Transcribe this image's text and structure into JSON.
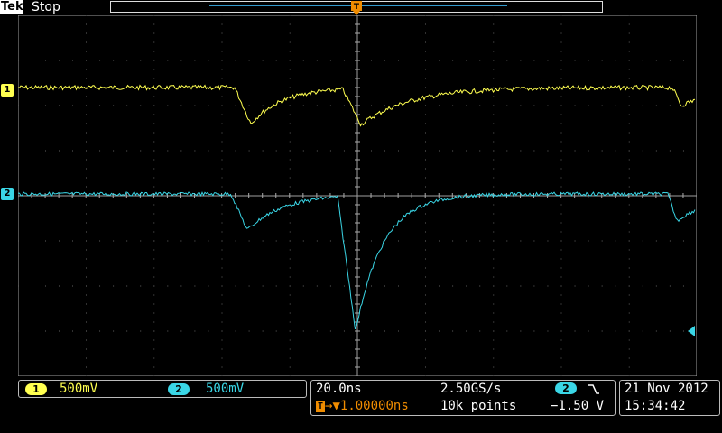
{
  "header": {
    "brand": "Tek",
    "acq_state": "Stop",
    "trigger_flag": "T"
  },
  "channels": [
    {
      "number": "1",
      "scale": "500mV",
      "color": "#ffff50"
    },
    {
      "number": "2",
      "scale": "500mV",
      "color": "#3ad6e6"
    }
  ],
  "horizontal": {
    "timebase": "20.0ns",
    "sample_rate": "2.50GS/s",
    "trigger_position": "1.00000ns",
    "record_length": "10k points"
  },
  "trigger": {
    "source": "2",
    "slope_icon": "falling-edge-icon",
    "level": "−1.50 V"
  },
  "datetime": {
    "date": "21 Nov 2012",
    "time": "15:34:42"
  },
  "colors": {
    "ch1": "#ffff50",
    "ch2": "#3ad6e6",
    "trigger": "#f08c00",
    "graticule": "#9a9a9a"
  }
}
